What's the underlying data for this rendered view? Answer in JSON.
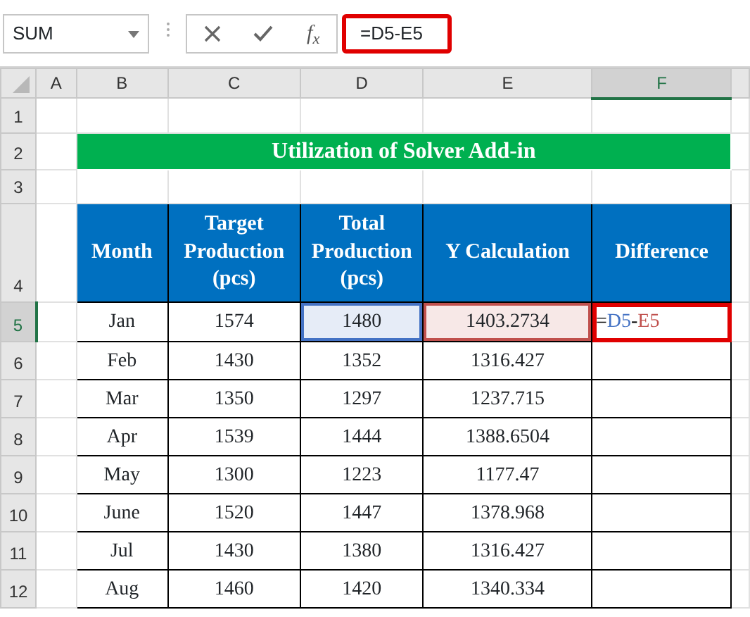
{
  "name_box": {
    "value": "SUM"
  },
  "formula_bar": {
    "function_label": "f$_{x}$",
    "formula": "=D5-E5",
    "highlighted": true
  },
  "columns": [
    {
      "label": "A",
      "selected": false
    },
    {
      "label": "B",
      "selected": false
    },
    {
      "label": "C",
      "selected": false
    },
    {
      "label": "D",
      "selected": false
    },
    {
      "label": "E",
      "selected": false
    },
    {
      "label": "F",
      "selected": true
    }
  ],
  "rows": [
    {
      "label": "1",
      "selected": false
    },
    {
      "label": "2",
      "selected": false
    },
    {
      "label": "3",
      "selected": false
    },
    {
      "label": "4",
      "selected": false
    },
    {
      "label": "5",
      "selected": true
    },
    {
      "label": "6",
      "selected": false
    },
    {
      "label": "7",
      "selected": false
    },
    {
      "label": "8",
      "selected": false
    },
    {
      "label": "9",
      "selected": false
    },
    {
      "label": "10",
      "selected": false
    },
    {
      "label": "11",
      "selected": false
    },
    {
      "label": "12",
      "selected": false
    }
  ],
  "title": "Utilization of Solver Add-in",
  "table": {
    "columns": [
      "Month",
      "Target Production (pcs)",
      "Total Production (pcs)",
      "Y Calculation",
      "Difference"
    ],
    "rows": [
      {
        "cells": [
          {
            "text": "Jan"
          },
          {
            "text": "1574"
          },
          {
            "text": "1480",
            "color": "#4472c4"
          },
          {
            "text": "1403.2734",
            "color": "#c0504d"
          },
          {
            "kind": "editing",
            "highlighted": true,
            "tokens": [
              {
                "text": "=",
                "color": "#000000"
              },
              {
                "text": "D5",
                "color": "#4472c4"
              },
              {
                "text": "-",
                "color": "#000000"
              },
              {
                "text": "E5",
                "color": "#c0504d"
              }
            ]
          }
        ]
      },
      {
        "cells": [
          {
            "text": "Feb"
          },
          {
            "text": "1430"
          },
          {
            "text": "1352"
          },
          {
            "text": "1316.427"
          }
        ]
      },
      {
        "cells": [
          {
            "text": "Mar"
          },
          {
            "text": "1350"
          },
          {
            "text": "1297"
          },
          {
            "text": "1237.715"
          }
        ]
      },
      {
        "cells": [
          {
            "text": "Apr"
          },
          {
            "text": "1539"
          },
          {
            "text": "1444"
          },
          {
            "text": "1388.6504"
          }
        ]
      },
      {
        "cells": [
          {
            "text": "May"
          },
          {
            "text": "1300"
          },
          {
            "text": "1223"
          },
          {
            "text": "1177.47"
          }
        ]
      },
      {
        "cells": [
          {
            "text": "June"
          },
          {
            "text": "1520"
          },
          {
            "text": "1447"
          },
          {
            "text": "1378.968"
          }
        ]
      },
      {
        "cells": [
          {
            "text": "Jul"
          },
          {
            "text": "1430"
          },
          {
            "text": "1380"
          },
          {
            "text": "1316.427"
          }
        ]
      },
      {
        "cells": [
          {
            "text": "Aug"
          },
          {
            "text": "1460"
          },
          {
            "text": "1420"
          },
          {
            "text": "1340.334"
          }
        ]
      }
    ]
  }
}
